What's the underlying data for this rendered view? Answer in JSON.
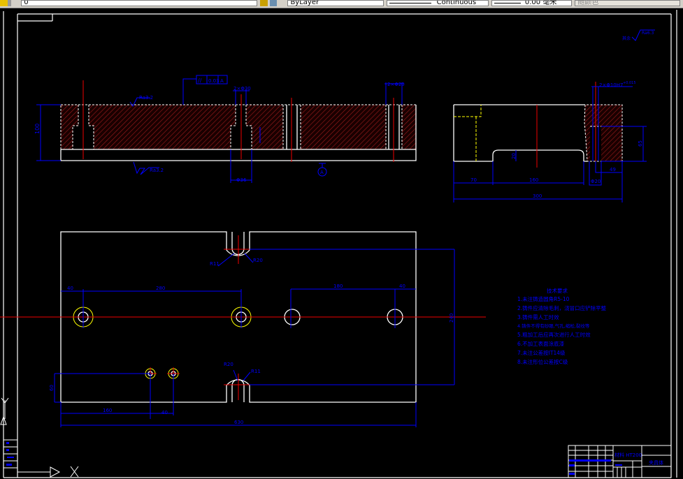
{
  "toolbar": {
    "layer_value": "0",
    "color_value": "ByLayer",
    "linetype_value": "Continuous",
    "lineweight_value": "0.00 毫米",
    "plotstyle_value": "随颜色"
  },
  "colors": {
    "geometry": "#ffffff",
    "dimension": "#0000ff",
    "centerline": "#ff0000",
    "hidden": "#ffff00",
    "hatch": "#8b1a1a",
    "background": "#000000"
  },
  "front_view": {
    "dim_height": "100",
    "roughness_top": "Ra3.2",
    "roughness_bottom": "Ra3.2",
    "tolerance_symbol": "//",
    "tolerance_value": "0.03",
    "tolerance_datum": "A",
    "hole_callout_1": "2×Φ30",
    "hole_callout_2": "2×Φ20",
    "dim_counterbore": "Φ36",
    "datum_label": "A"
  },
  "side_view": {
    "hole_callout": "2×Φ10H7",
    "hole_tolerance": "+0.015",
    "dim_65": "65",
    "dim_20": "20",
    "dim_49": "49",
    "dim_phi20": "Φ20",
    "dim_70": "70",
    "dim_160": "160",
    "dim_300": "300"
  },
  "plan_view": {
    "r11_top": "R11",
    "r20_top": "R20",
    "r20_bottom": "R20",
    "r11_bottom": "R11",
    "dim_40_left": "40",
    "dim_280": "280",
    "dim_180": "180",
    "dim_40_right": "40",
    "dim_240": "240",
    "dim_60": "60",
    "dim_160": "160",
    "dim_40_bottom": "40",
    "dim_630": "630"
  },
  "other_roughness": {
    "label": "其余",
    "value": "Ra6.3"
  },
  "tech_requirements": {
    "title": "技术要求",
    "items": [
      "1.未注铸造圆角R5-10",
      "2.铸件应清除毛刺，浇冒口应铲除平整",
      "3.铸件需人工时效",
      "4.铸件不得有砂眼,气孔,缩松,裂纹等",
      "5.粗加工后应再次进行人工时效",
      "6.不加工表面涂底漆",
      "7.未注公差按IT14级",
      "8.未注形位公差按C级"
    ]
  },
  "title_block": {
    "material": "材料 HT200",
    "part_name": "夹具体"
  },
  "ucs": {
    "x_label": "X",
    "y_label": "Y"
  }
}
